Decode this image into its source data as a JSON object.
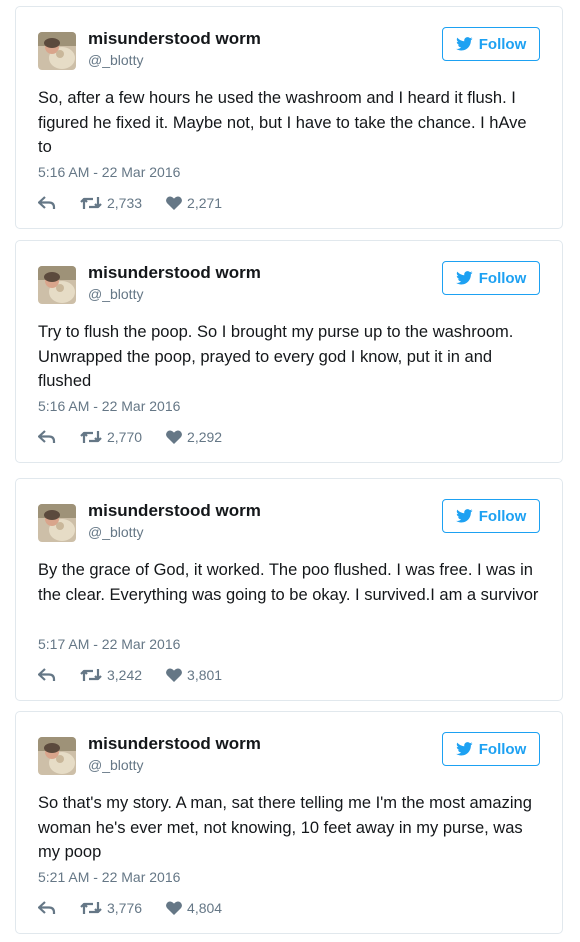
{
  "colors": {
    "accent": "#1da1f2",
    "text": "#14171a",
    "muted": "#657786",
    "border": "#e1e8ed"
  },
  "icons": {
    "reply": "reply-icon",
    "retweet": "retweet-icon",
    "like": "heart-icon",
    "follow": "twitter-bird-icon"
  },
  "tweets": [
    {
      "author": {
        "name": "misunderstood worm",
        "handle": "@_blotty"
      },
      "follow_label": "Follow",
      "text": "So, after a few hours he used the washroom and I heard it flush. I figured he fixed it. Maybe not, but I have to take the chance. I hAve to",
      "timestamp": "5:16 AM - 22 Mar 2016",
      "retweets": "2,733",
      "likes": "2,271"
    },
    {
      "author": {
        "name": "misunderstood worm",
        "handle": "@_blotty"
      },
      "follow_label": "Follow",
      "text": "Try to flush the poop. So I brought my purse up to the washroom. Unwrapped the poop, prayed to every god I know, put it in and flushed",
      "timestamp": "5:16 AM - 22 Mar 2016",
      "retweets": "2,770",
      "likes": "2,292"
    },
    {
      "author": {
        "name": "misunderstood worm",
        "handle": "@_blotty"
      },
      "follow_label": "Follow",
      "text": "By the grace of God, it worked. The poo flushed. I was free. I was in the clear. Everything was going to be okay. I survived.I am a survivor",
      "timestamp": "5:17 AM - 22 Mar 2016",
      "retweets": "3,242",
      "likes": "3,801"
    },
    {
      "author": {
        "name": "misunderstood worm",
        "handle": "@_blotty"
      },
      "follow_label": "Follow",
      "text": "So that's my story. A man, sat there telling me I'm the most amazing woman he's ever met, not knowing, 10 feet away in my purse, was my poop",
      "timestamp": "5:21 AM - 22 Mar 2016",
      "retweets": "3,776",
      "likes": "4,804"
    }
  ]
}
